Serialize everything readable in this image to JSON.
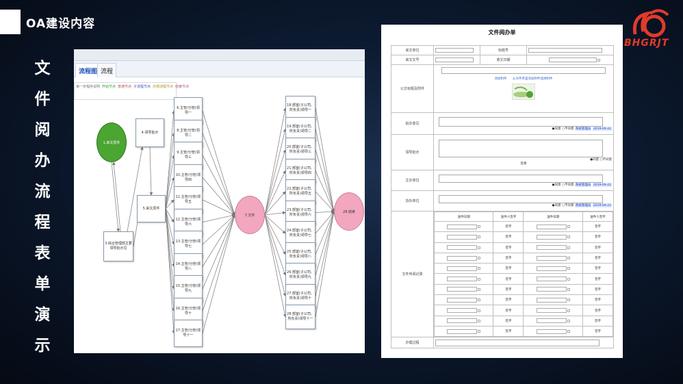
{
  "slide": {
    "title": "OA建设内容",
    "vertical_title": [
      "文",
      "件",
      "阅",
      "办",
      "流",
      "程",
      "表",
      "单",
      "演",
      "示"
    ],
    "logo_text": "BHGRJT"
  },
  "flow": {
    "tabs": [
      "流程图",
      "流程"
    ],
    "legend": [
      "第一步程序说明",
      "开始节点",
      "普通节点",
      "子流程节点",
      "外部流程节点",
      "结束节点"
    ],
    "nodes": {
      "start": "1.来文原件",
      "n4": "4.领导批示",
      "n5": "5.来文原件",
      "n3": "3.综合管理部主要领导批示见",
      "mid": "7.文件",
      "end": "28.结束",
      "left_col": [
        "6.主管/分管(领导一",
        "8.主管/分管(领导二",
        "9.主管/分管(领导三",
        "10.主管/分管(领导四",
        "11.主管/分管(领导五",
        "12.主管/分管(领导六",
        "13.主管/分管(领导七",
        "14.主管/分管(领导八",
        "15.主管/分管(领导九",
        "16.主管/分管(领导十",
        "17.主管/分管(领导十一"
      ],
      "right_col": [
        "18.部室(子公司、所负责)领导一",
        "19.部室(子公司、所负责)领导二",
        "20.部室(子公司、所负责)领导三",
        "21.部室(子公司、所负责)领导四",
        "22.部室(子公司、所负责)领导五",
        "23.部室(子公司、所负责)领导六",
        "24.部室(子公司、所负责)领导七",
        "25.部室(子公司、所负责)领导八",
        "26.部室(子公司、所负责)领导九",
        "27.部室(子公司、所负责)领导十",
        "28.部室(子公司、所负责)领导十一"
      ]
    }
  },
  "form": {
    "title": "文件阅办单",
    "labels": {
      "laiwen_danwei": "来文单位",
      "biaoti": "标题号",
      "laiwen_wenhao": "来文文号",
      "shouwen_riqi": "收文日期",
      "attach": "公文标题及附件",
      "nibao": "拟办意见",
      "lingdao": "领导批示",
      "zhuban": "主办单位",
      "xieban": "协办单位",
      "chuanyue": "文件传阅记录",
      "banli": "办理过程"
    },
    "attach_links": [
      "添加附件",
      "从文件夹里添加附件选择附件"
    ],
    "opts": {
      "agree": "●同意",
      "disagree": "○不同意",
      "stamp": "系统管理员",
      "date": "2019-09-22"
    },
    "lingdao_sign": "签章",
    "circ_headers": [
      "送件日期",
      "送件人签字",
      "送件日期",
      "送件人签字"
    ],
    "sign": "签字"
  }
}
